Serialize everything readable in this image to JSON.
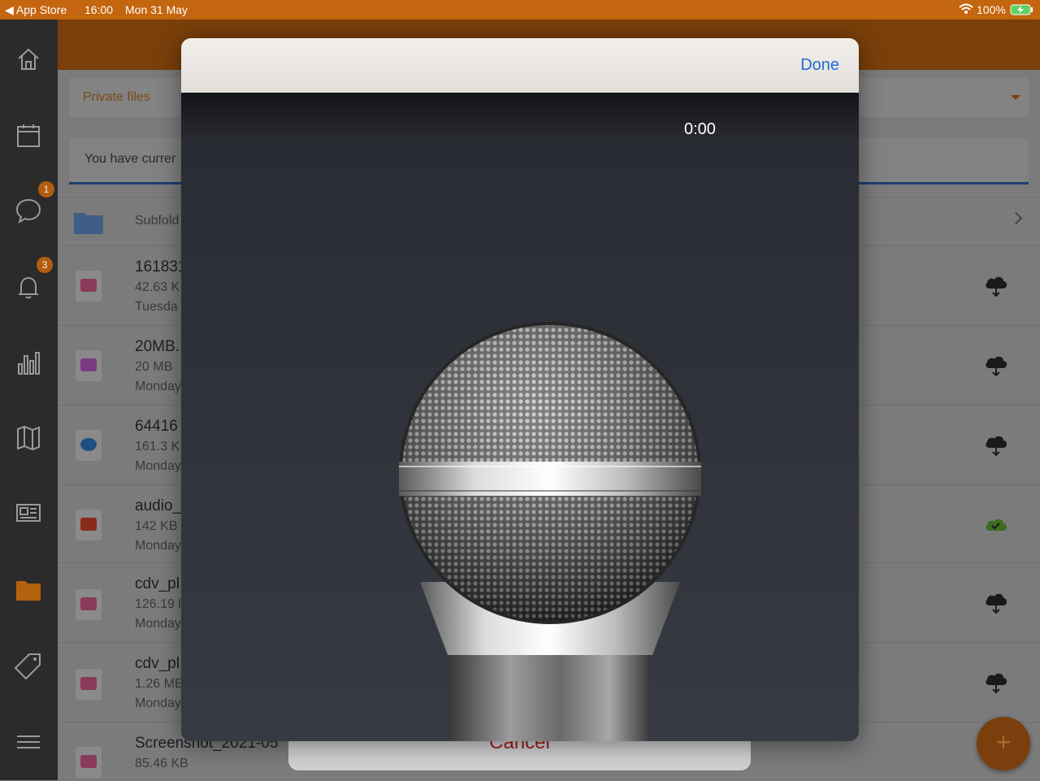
{
  "status_bar": {
    "back_app": "App Store",
    "time": "16:00",
    "date": "Mon 31 May",
    "battery": "100%"
  },
  "sidebar": {
    "items": [
      {
        "name": "home-icon"
      },
      {
        "name": "calendar-icon"
      },
      {
        "name": "chat-icon",
        "badge": "1"
      },
      {
        "name": "bell-icon",
        "badge": "3"
      },
      {
        "name": "chart-icon"
      },
      {
        "name": "map-icon"
      },
      {
        "name": "news-icon"
      },
      {
        "name": "folder-icon"
      },
      {
        "name": "tag-icon"
      },
      {
        "name": "menu-icon"
      }
    ]
  },
  "files": {
    "dropdown_label": "Private files",
    "notice": "You have currer",
    "subfolder_label": "Subfold",
    "rows": [
      {
        "name": "161831",
        "size": "42.63 K",
        "date": "Tuesda",
        "icon": "image-file-icon",
        "cloud": "download"
      },
      {
        "name": "20MB.",
        "size": "20 MB",
        "date": "Monday",
        "icon": "video-file-icon",
        "cloud": "download"
      },
      {
        "name": "64416",
        "size": "161.3 K",
        "date": "Monday",
        "icon": "quicktime-file-icon",
        "cloud": "download"
      },
      {
        "name": "audio_",
        "size": "142 KB",
        "date": "Monday",
        "icon": "audio-file-icon",
        "cloud": "synced"
      },
      {
        "name": "cdv_pl",
        "size": "126.19 l",
        "date": "Monday",
        "icon": "image-file-icon",
        "cloud": "download"
      },
      {
        "name": "cdv_pl",
        "size": "1.26 ME",
        "date": "Monday",
        "icon": "image-file-icon",
        "cloud": "download"
      },
      {
        "name": "Screenshot_2021-05",
        "size": "85.46 KB",
        "date": "",
        "icon": "image-file-icon",
        "cloud": "download"
      }
    ],
    "fab_label": "+"
  },
  "action_sheet": {
    "cancel_label": "Cancel"
  },
  "recorder_modal": {
    "done_label": "Done",
    "timer": "0:00"
  },
  "colors": {
    "accent_orange": "#c4650f",
    "done_blue": "#1a6fd6",
    "cancel_red": "#a02020",
    "synced_green": "#3f6b1e"
  }
}
